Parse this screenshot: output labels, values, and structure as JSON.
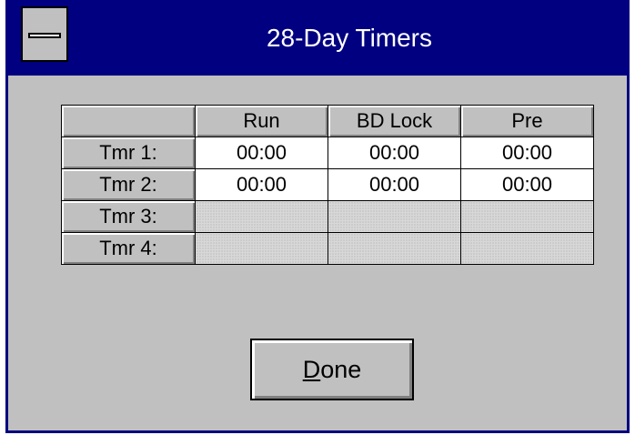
{
  "window": {
    "title": "28-Day Timers"
  },
  "grid": {
    "columns": [
      "Run",
      "BD Lock",
      "Pre"
    ],
    "rows": [
      {
        "label": "Tmr 1:",
        "values": [
          "00:00",
          "00:00",
          "00:00"
        ],
        "enabled": true
      },
      {
        "label": "Tmr 2:",
        "values": [
          "00:00",
          "00:00",
          "00:00"
        ],
        "enabled": true
      },
      {
        "label": "Tmr 3:",
        "values": [
          "",
          "",
          ""
        ],
        "enabled": false
      },
      {
        "label": "Tmr 4:",
        "values": [
          "",
          "",
          ""
        ],
        "enabled": false
      }
    ]
  },
  "buttons": {
    "done_mnemonic": "D",
    "done_rest": "one"
  },
  "colors": {
    "title_bar": "#000080",
    "dialog_face": "#c0c0c0",
    "cell_background": "#ffffff"
  }
}
